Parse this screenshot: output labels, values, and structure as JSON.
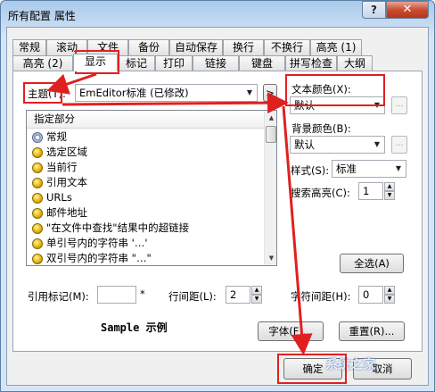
{
  "window": {
    "title": "所有配置 属性",
    "help": "?",
    "close": "✕"
  },
  "tabs_row1": [
    "常规",
    "滚动",
    "文件",
    "备份",
    "自动保存",
    "换行",
    "不换行",
    "高亮 (1)"
  ],
  "tabs_row2": [
    "高亮 (2)",
    "显示",
    "标记",
    "打印",
    "链接",
    "键盘",
    "拼写检查",
    "大纲"
  ],
  "active_tab": "显示",
  "theme": {
    "label": "主题(T):",
    "value": "EmEditor标准 (已修改)",
    "more_button": ">"
  },
  "list": {
    "header": "指定部分",
    "items": [
      {
        "text": "常规",
        "icon": "gear-icon"
      },
      {
        "text": "选定区域",
        "icon": "smiley-icon"
      },
      {
        "text": "当前行",
        "icon": "smiley-icon"
      },
      {
        "text": "引用文本",
        "icon": "smiley-icon"
      },
      {
        "text": "URLs",
        "icon": "smiley-icon"
      },
      {
        "text": "邮件地址",
        "icon": "smiley-icon"
      },
      {
        "text": "\"在文件中查找\"结果中的超链接",
        "icon": "smiley-icon"
      },
      {
        "text": "单引号内的字符串 '…'",
        "icon": "smiley-icon"
      },
      {
        "text": "双引号内的字符串 \"…\"",
        "icon": "smiley-icon"
      }
    ]
  },
  "text_color": {
    "label": "文本颜色(X):",
    "value": "默认",
    "more": "…"
  },
  "bg_color": {
    "label": "背景颜色(B):",
    "value": "默认",
    "more": "…"
  },
  "style": {
    "label": "样式(S):",
    "value": "标准"
  },
  "search_highlight": {
    "label": "搜索高亮(C):",
    "value": "1"
  },
  "select_all": "全选(A)",
  "quote_mark": {
    "label": "引用标记(M):",
    "value": "",
    "asterisk": "*"
  },
  "line_spacing": {
    "label": "行间距(L):",
    "value": "2"
  },
  "char_spacing": {
    "label": "字符间距(H):",
    "value": "0"
  },
  "sample": "Sample 示例",
  "font_button": "字体(F)...",
  "reset_button": "重置(R)...",
  "ok_button": "确定",
  "cancel_button": "取消",
  "watermark": "系统之家",
  "colors": {
    "annotation": "#e02020",
    "titlebar": "#a9c9ea",
    "close": "#c94d33"
  }
}
